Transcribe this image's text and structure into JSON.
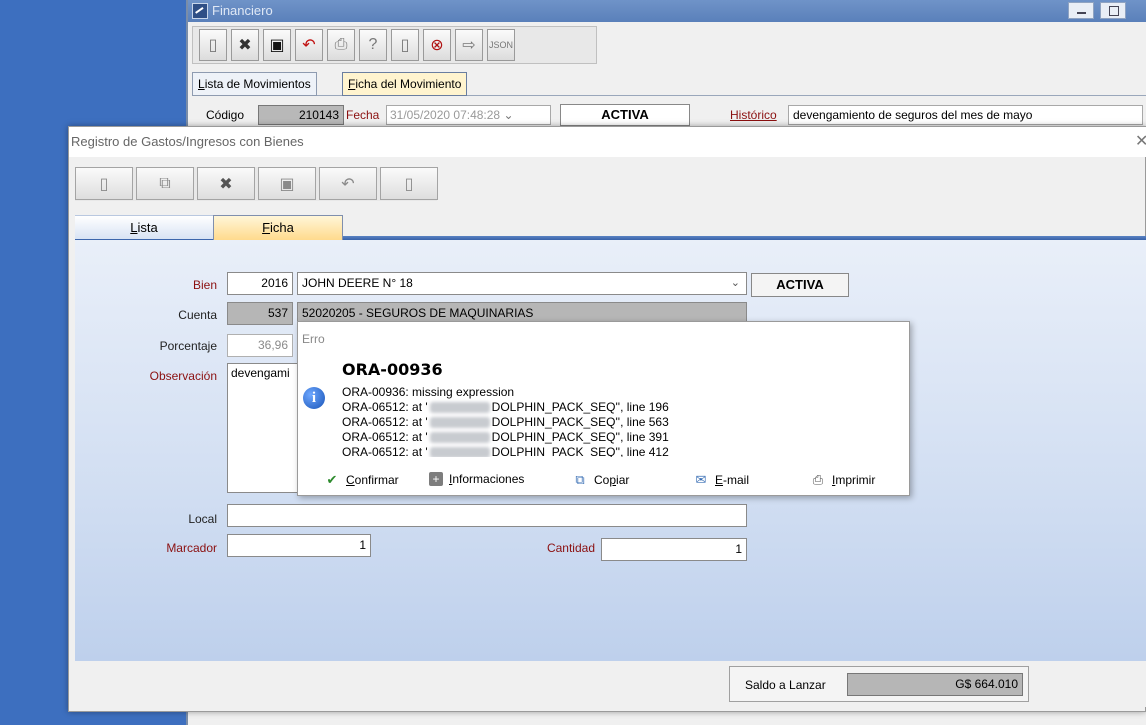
{
  "bg_window": {
    "title": "Financiero",
    "tabs": [
      {
        "prefix": "",
        "mnemonic": "L",
        "rest": "ista de Movimientos"
      },
      {
        "prefix": "",
        "mnemonic": "F",
        "rest": "icha del Movimiento"
      }
    ],
    "codigo_label": "Código",
    "codigo_value": "210143",
    "fecha_label": "Fecha",
    "fecha_value": "31/05/2020 07:48:28",
    "status": "ACTIVA",
    "historico_label": "Histórico",
    "historico_value": "devengamiento de seguros del mes de mayo"
  },
  "dialog": {
    "title": "Registro de Gastos/Ingresos con Bienes",
    "tabs": [
      {
        "prefix": "",
        "mnemonic": "L",
        "rest": "ista"
      },
      {
        "prefix": "",
        "mnemonic": "F",
        "rest": "icha"
      }
    ],
    "form": {
      "bien_label": "Bien",
      "bien_code": "2016",
      "bien_name": "JOHN DEERE N° 18",
      "status_button": "ACTIVA",
      "cuenta_label": "Cuenta",
      "cuenta_code": "537",
      "cuenta_desc": "52020205 - SEGUROS DE MAQUINARIAS",
      "porcentaje_label": "Porcentaje",
      "porcentaje_value": "36,96",
      "observacion_label": "Observación",
      "observacion_value": "devengami",
      "local_label": "Local",
      "local_value": "",
      "marcador_label": "Marcador",
      "marcador_value": "1",
      "cantidad_label": "Cantidad",
      "cantidad_value": "1"
    },
    "footer": {
      "saldo_label": "Saldo a Lanzar",
      "saldo_value": "G$ 664.010"
    }
  },
  "error_popup": {
    "title": "Erro",
    "heading": "ORA-00936",
    "line1": "ORA-00936: missing expression",
    "lines": [
      {
        "pre": "ORA-06512: at '",
        "post": "DOLPHIN_PACK_SEQ'', line 196"
      },
      {
        "pre": "ORA-06512: at '",
        "post": "DOLPHIN_PACK_SEQ'', line 563"
      },
      {
        "pre": "ORA-06512: at '",
        "post": "DOLPHIN_PACK_SEQ'', line 391"
      },
      {
        "pre": "ORA-06512: at '",
        "post": "DOLPHIN_PACK_SEQ'', line 412"
      }
    ],
    "actions": {
      "confirmar": {
        "mnemonic": "C",
        "rest": "onfirmar"
      },
      "informaciones": {
        "mnemonic": "I",
        "rest": "nformaciones"
      },
      "copiar": {
        "pre": "Co",
        "mnemonic": "p",
        "rest": "iar"
      },
      "email": {
        "mnemonic": "E",
        "rest": "-mail"
      },
      "imprimir": {
        "mnemonic": "I",
        "rest": "mprimir"
      }
    }
  }
}
